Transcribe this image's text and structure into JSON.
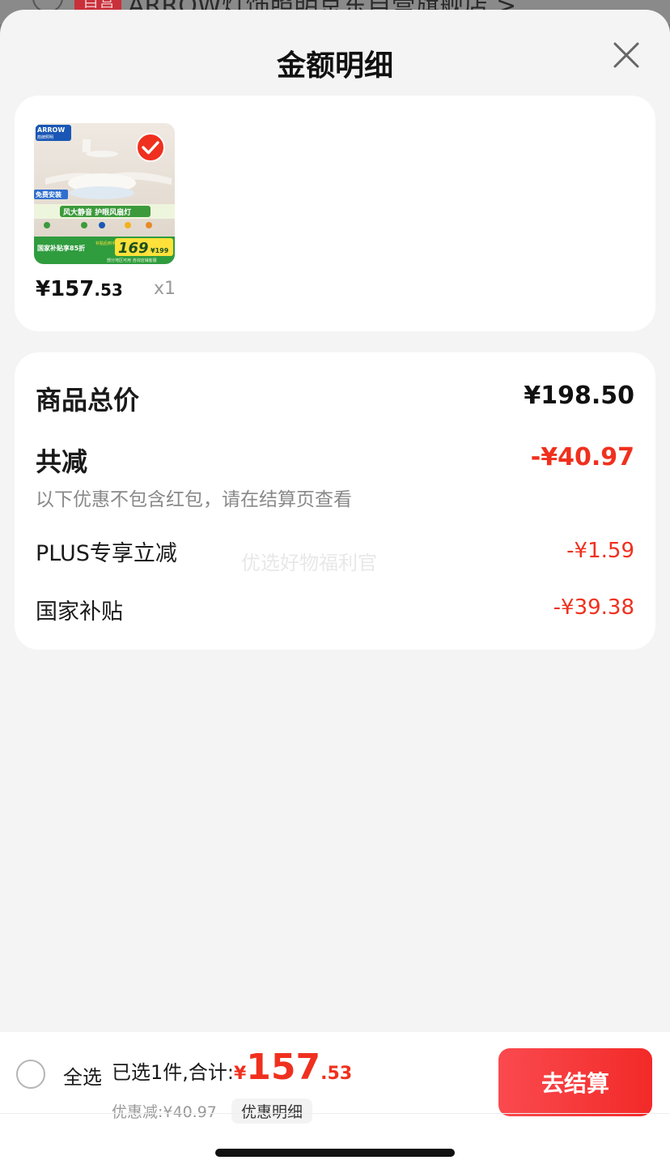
{
  "underlay": {
    "badge": "自营",
    "store_title": "ARROW灯饰照明京东自营旗舰店 >"
  },
  "sheet": {
    "title": "金额明细",
    "close_icon": "close-icon"
  },
  "product": {
    "thumb_text": {
      "brand": "ARROW",
      "brand_sub": "箭牌照明",
      "install": "免费安装",
      "slogan": "风大静音 护眼风扇灯",
      "subsidy": "国家补贴享85折",
      "after_label": "补贴后到手价",
      "price_big": "169",
      "price_small": "¥199",
      "note": "部分地区可用 咨询店铺客服"
    },
    "selected": true,
    "price_int": "¥157",
    "price_dec": ".53",
    "qty": "x1"
  },
  "price_detail": {
    "total_label": "商品总价",
    "total_value": "¥198.50",
    "reduce_label": "共减",
    "reduce_value": "-¥40.97",
    "reduce_note": "以下优惠不包含红包，请在结算页查看",
    "items": [
      {
        "label": "PLUS专享立减",
        "value": "-¥1.59"
      },
      {
        "label": "国家补贴",
        "value": "-¥39.38"
      }
    ],
    "watermark": "优选好物福利官"
  },
  "bottom_bar": {
    "select_all": "全选",
    "summary_text": "已选1件,合计:",
    "sum_yen": "¥",
    "sum_int": "157",
    "sum_dec": ".53",
    "discount": "优惠减:¥40.97",
    "detail_link": "优惠明细",
    "checkout": "去结算"
  },
  "colors": {
    "accent_red": "#f0301e",
    "checkout_gradient_start": "#fa4a4f",
    "checkout_gradient_end": "#f22a28",
    "sheet_bg": "#f4f4f4"
  }
}
